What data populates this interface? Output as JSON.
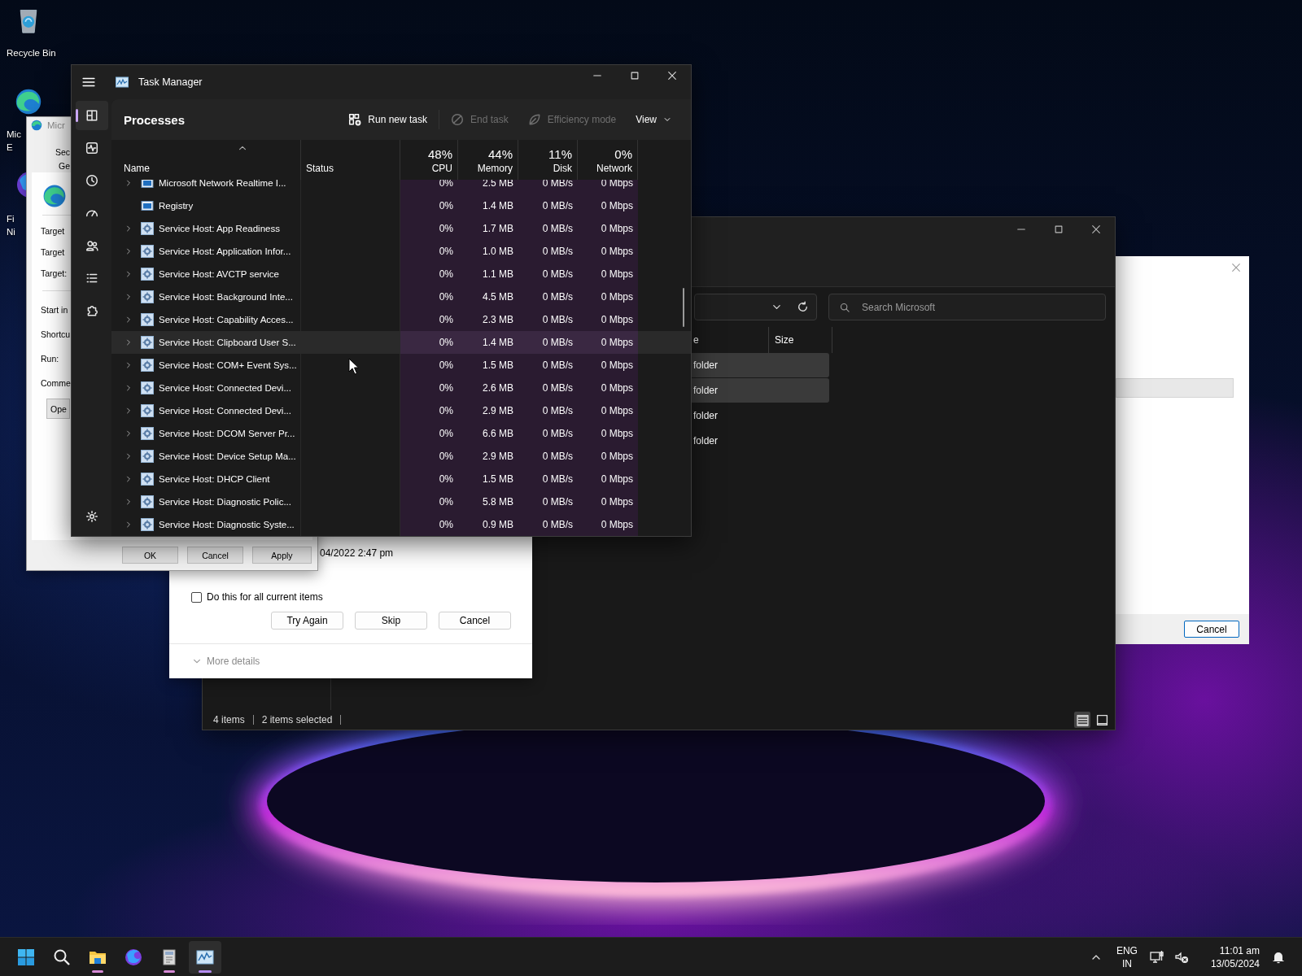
{
  "desktop_icons": [
    {
      "kind": "recycle-bin",
      "lines": [
        "Recycle Bin"
      ]
    },
    {
      "kind": "edge",
      "lines": [
        "Mic",
        "E"
      ]
    },
    {
      "kind": "firefox",
      "lines": [
        "Fi",
        "Ni"
      ]
    }
  ],
  "side_dialog": {
    "buttons": [
      "Cancel"
    ]
  },
  "explorer": {
    "columns": [
      "e",
      "Size"
    ],
    "search": {
      "placeholder": "Search Microsoft"
    },
    "rows": [
      {
        "type": "folder",
        "selected": true
      },
      {
        "type": "folder",
        "selected": true
      },
      {
        "type": "folder",
        "selected": false
      },
      {
        "type": "folder",
        "selected": false
      }
    ],
    "status_bar": {
      "count": "4 items",
      "selection": "2 items selected"
    },
    "view_modes": [
      {
        "kind": "details",
        "selected": true
      },
      {
        "kind": "tiles",
        "selected": false
      }
    ]
  },
  "copy_dialog": {
    "date": "04/2022 2:47 pm",
    "checkbox": {
      "label": "Do this for all current items",
      "checked": false
    },
    "buttons": [
      "Try Again",
      "Skip",
      "Cancel"
    ],
    "more_details": "More details"
  },
  "properties_window": {
    "title": "Micr",
    "tabs": [
      "Sec",
      "Ge"
    ],
    "labels": [
      "Target",
      "Target",
      "Target:",
      "Start in",
      "Shortcu",
      "Run:",
      "Comme"
    ],
    "open_button": "Ope",
    "buttons": [
      "OK",
      "Cancel",
      "Apply"
    ]
  },
  "task_manager": {
    "title": "Task Manager",
    "nav": [
      {
        "kind": "processes",
        "selected": true
      },
      {
        "kind": "performance",
        "selected": false
      },
      {
        "kind": "history",
        "selected": false
      },
      {
        "kind": "startup",
        "selected": false
      },
      {
        "kind": "users",
        "selected": false
      },
      {
        "kind": "details",
        "selected": false
      },
      {
        "kind": "services",
        "selected": false
      },
      {
        "kind": "settings",
        "selected": false
      }
    ],
    "page_title": "Processes",
    "toolbar": [
      {
        "kind": "run",
        "label": "Run new task",
        "disabled": false
      },
      {
        "kind": "end",
        "label": "End task",
        "disabled": true
      },
      {
        "kind": "efficiency",
        "label": "Efficiency mode",
        "disabled": true
      },
      {
        "kind": "view",
        "label": "View",
        "disabled": false
      }
    ],
    "columns": [
      {
        "label": "Name"
      },
      {
        "label": "Status"
      },
      {
        "usage": "48%",
        "label": "CPU"
      },
      {
        "usage": "44%",
        "label": "Memory"
      },
      {
        "usage": "11%",
        "label": "Disk"
      },
      {
        "usage": "0%",
        "label": "Network"
      }
    ],
    "rows": [
      {
        "kind": "app",
        "name": "Microsoft Network Realtime I...",
        "expandable": true,
        "highlighted": false,
        "cpu": "0%",
        "memory": "2.5 MB",
        "disk": "0 MB/s",
        "network": "0 Mbps"
      },
      {
        "kind": "app",
        "name": "Registry",
        "expandable": false,
        "highlighted": false,
        "cpu": "0%",
        "memory": "1.4 MB",
        "disk": "0 MB/s",
        "network": "0 Mbps"
      },
      {
        "kind": "service",
        "name": "Service Host: App Readiness",
        "expandable": true,
        "highlighted": false,
        "cpu": "0%",
        "memory": "1.7 MB",
        "disk": "0 MB/s",
        "network": "0 Mbps"
      },
      {
        "kind": "service",
        "name": "Service Host: Application Infor...",
        "expandable": true,
        "highlighted": false,
        "cpu": "0%",
        "memory": "1.0 MB",
        "disk": "0 MB/s",
        "network": "0 Mbps"
      },
      {
        "kind": "service",
        "name": "Service Host: AVCTP service",
        "expandable": true,
        "highlighted": false,
        "cpu": "0%",
        "memory": "1.1 MB",
        "disk": "0 MB/s",
        "network": "0 Mbps"
      },
      {
        "kind": "service",
        "name": "Service Host: Background Inte...",
        "expandable": true,
        "highlighted": false,
        "cpu": "0%",
        "memory": "4.5 MB",
        "disk": "0 MB/s",
        "network": "0 Mbps"
      },
      {
        "kind": "service",
        "name": "Service Host: Capability Acces...",
        "expandable": true,
        "highlighted": false,
        "cpu": "0%",
        "memory": "2.3 MB",
        "disk": "0 MB/s",
        "network": "0 Mbps"
      },
      {
        "kind": "service",
        "name": "Service Host: Clipboard User S...",
        "expandable": true,
        "highlighted": true,
        "cpu": "0%",
        "memory": "1.4 MB",
        "disk": "0 MB/s",
        "network": "0 Mbps"
      },
      {
        "kind": "service",
        "name": "Service Host: COM+ Event Sys...",
        "expandable": true,
        "highlighted": false,
        "cpu": "0%",
        "memory": "1.5 MB",
        "disk": "0 MB/s",
        "network": "0 Mbps"
      },
      {
        "kind": "service",
        "name": "Service Host: Connected Devi...",
        "expandable": true,
        "highlighted": false,
        "cpu": "0%",
        "memory": "2.6 MB",
        "disk": "0 MB/s",
        "network": "0 Mbps"
      },
      {
        "kind": "service",
        "name": "Service Host: Connected Devi...",
        "expandable": true,
        "highlighted": false,
        "cpu": "0%",
        "memory": "2.9 MB",
        "disk": "0 MB/s",
        "network": "0 Mbps"
      },
      {
        "kind": "service",
        "name": "Service Host: DCOM Server Pr...",
        "expandable": true,
        "highlighted": false,
        "cpu": "0%",
        "memory": "6.6 MB",
        "disk": "0 MB/s",
        "network": "0 Mbps"
      },
      {
        "kind": "service",
        "name": "Service Host: Device Setup Ma...",
        "expandable": true,
        "highlighted": false,
        "cpu": "0%",
        "memory": "2.9 MB",
        "disk": "0 MB/s",
        "network": "0 Mbps"
      },
      {
        "kind": "service",
        "name": "Service Host: DHCP Client",
        "expandable": true,
        "highlighted": false,
        "cpu": "0%",
        "memory": "1.5 MB",
        "disk": "0 MB/s",
        "network": "0 Mbps"
      },
      {
        "kind": "service",
        "name": "Service Host: Diagnostic Polic...",
        "expandable": true,
        "highlighted": false,
        "cpu": "0%",
        "memory": "5.8 MB",
        "disk": "0 MB/s",
        "network": "0 Mbps"
      },
      {
        "kind": "service",
        "name": "Service Host: Diagnostic Syste...",
        "expandable": true,
        "highlighted": false,
        "cpu": "0%",
        "memory": "0.9 MB",
        "disk": "0 MB/s",
        "network": "0 Mbps"
      }
    ]
  },
  "taskbar": {
    "apps": [
      {
        "kind": "start",
        "running": false,
        "active": false
      },
      {
        "kind": "search",
        "running": false,
        "active": false
      },
      {
        "kind": "explorer",
        "running": true,
        "active": false
      },
      {
        "kind": "firefox",
        "running": false,
        "active": false
      },
      {
        "kind": "notepad",
        "running": true,
        "active": false
      },
      {
        "kind": "taskmanager",
        "running": true,
        "active": true
      }
    ],
    "tray": {
      "language": [
        "ENG",
        "IN"
      ],
      "time": "11:01 am",
      "date": "13/05/2024"
    }
  }
}
